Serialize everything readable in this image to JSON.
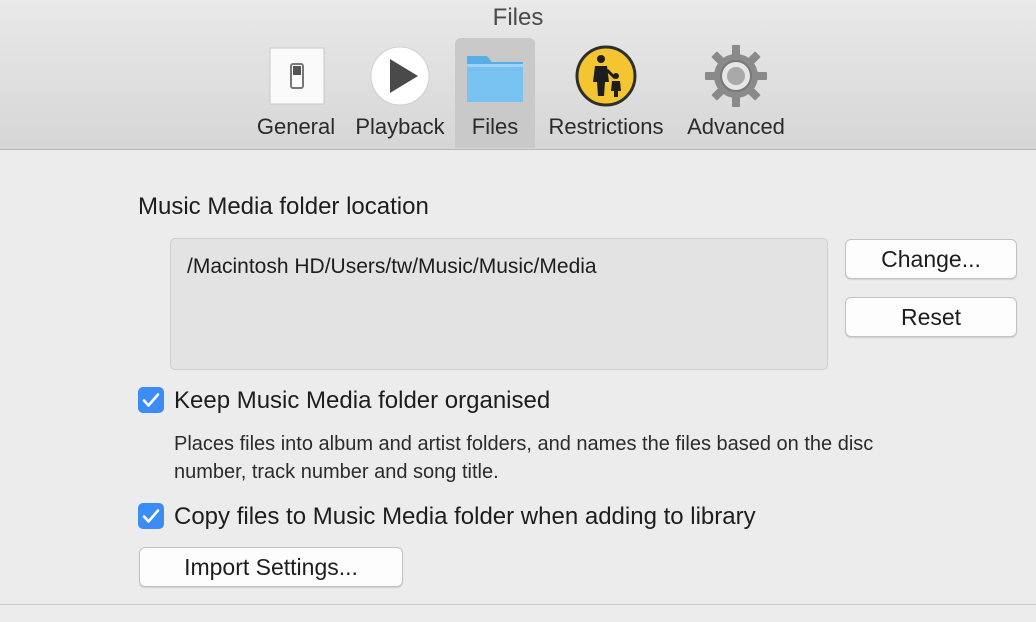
{
  "window": {
    "title": "Files"
  },
  "tabs": [
    {
      "label": "General",
      "icon": "switch-icon"
    },
    {
      "label": "Playback",
      "icon": "play-icon"
    },
    {
      "label": "Files",
      "icon": "folder-icon",
      "selected": true
    },
    {
      "label": "Restrictions",
      "icon": "parental-icon"
    },
    {
      "label": "Advanced",
      "icon": "gear-icon"
    }
  ],
  "location": {
    "label": "Music Media folder location",
    "path": "/Macintosh HD/Users/tw/Music/Music/Media",
    "change_label": "Change...",
    "reset_label": "Reset"
  },
  "options": {
    "keep_organised": {
      "label": "Keep Music Media folder organised",
      "checked": true,
      "description_line1": "Places files into album and artist folders, and names the files based on the disc",
      "description_line2": "number, track number and song title."
    },
    "copy_files": {
      "label": "Copy files to Music Media folder when adding to library",
      "checked": true
    }
  },
  "import_settings_label": "Import Settings...",
  "colors": {
    "accent": "#3b8df5",
    "folder": "#6cb8ee",
    "restrictions": "#f2c531"
  }
}
